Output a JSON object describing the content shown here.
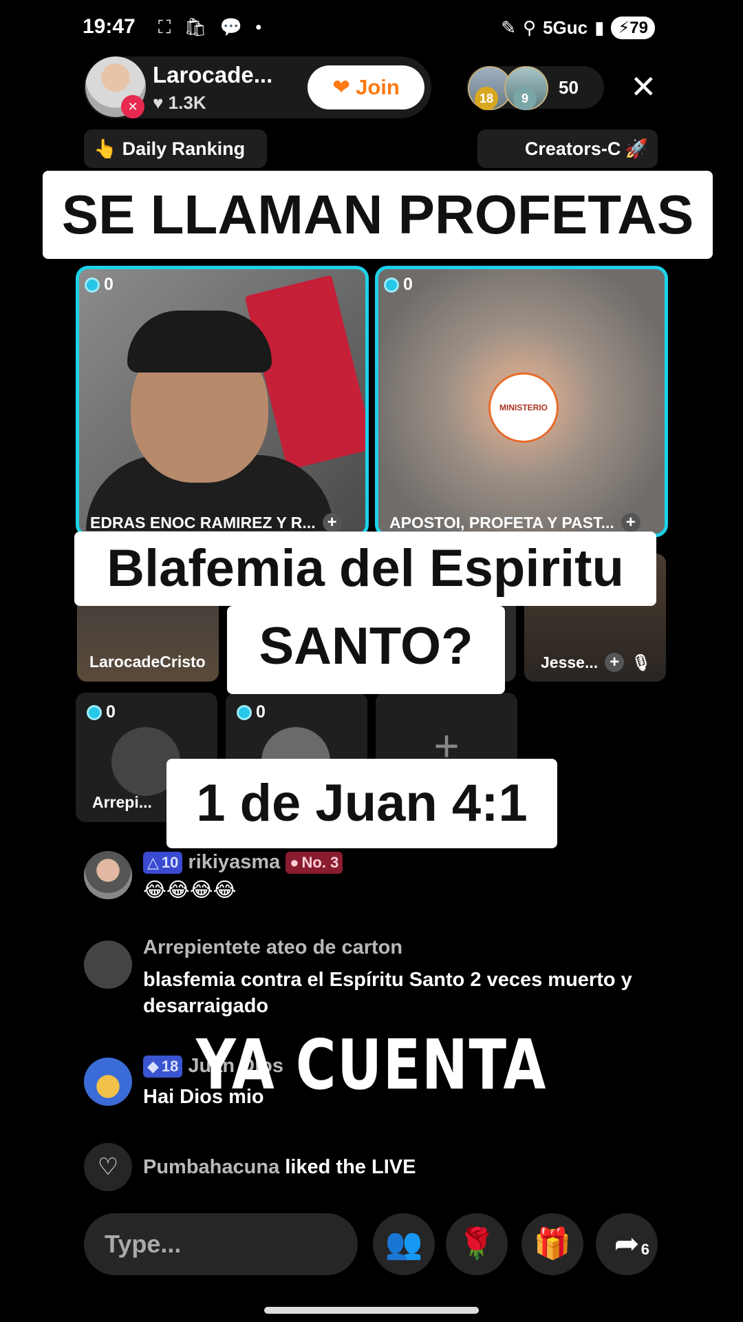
{
  "status_bar": {
    "time": "19:47",
    "left_icons": "⛶ 🛍 💬 •",
    "network": "5Guc",
    "battery": "79"
  },
  "host": {
    "name": "Larocade...",
    "likes": "1.3K",
    "join_label": "Join"
  },
  "viewers": {
    "badge1": "18",
    "badge2": "9",
    "count": "50"
  },
  "pills": {
    "daily_ranking": "Daily Ranking",
    "creators": "Creators-C"
  },
  "captions": {
    "top": "SE LLAMAN PROFETAS",
    "middle_line1": "Blafemia del Espiritu",
    "middle_line2": "SANTO?",
    "verse": "1 de Juan 4:1",
    "overlay": "YA CUENTA"
  },
  "tiles": {
    "t1": {
      "score": "0",
      "label": "EDRAS ENOC RAMIREZ Y R..."
    },
    "t2": {
      "score": "0",
      "label": "APOSTOI, PROFETA Y PAST...",
      "logo": "MINISTERIO"
    },
    "t3": {
      "label": "LarocadeCristo"
    },
    "t4": {
      "label": "Jesse..."
    },
    "t5": {
      "score": "0",
      "label": "Arrepi..."
    },
    "t6": {
      "score": "0"
    }
  },
  "chat": [
    {
      "level": "10",
      "name": "rikiyasma",
      "rank": "No. 3",
      "text": "😂😂😂😂"
    },
    {
      "name": "Arrepientete ateo de carton",
      "text": "blasfemia contra el Espíritu Santo  2 veces muerto y desarraigado"
    },
    {
      "level": "18",
      "name": "Juan Dios",
      "text": "Hai Dios mio"
    },
    {
      "name": "Pumbahacuna",
      "text": "liked the LIVE"
    }
  ],
  "bottom": {
    "type_placeholder": "Type...",
    "share_count": "6"
  }
}
